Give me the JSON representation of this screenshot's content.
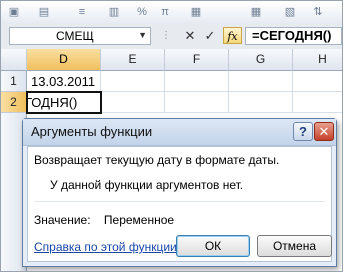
{
  "formula_bar": {
    "name_box": "СМЕЩ",
    "cancel_glyph": "✕",
    "enter_glyph": "✓",
    "fx_label": "fx",
    "formula": "=СЕГОДНЯ()"
  },
  "grid": {
    "columns": [
      "D",
      "E",
      "F",
      "G",
      "H"
    ],
    "rows": [
      "1",
      "2"
    ],
    "cells": {
      "d1": "13.03.2011",
      "d2": "ГОДНЯ()"
    }
  },
  "dialog": {
    "title": "Аргументы функции",
    "help_button": "?",
    "close_button": "✕",
    "description": "Возвращает текущую дату в формате даты.",
    "no_args": "У данной функции аргументов нет.",
    "value_label": "Значение:",
    "value_text": "Переменное",
    "help_link": "Справка по этой функции",
    "ok_label": "ОК",
    "cancel_label": "Отмена"
  },
  "colors": {
    "selected_header": "#f0bf5d",
    "dialog_border": "#5f7da3",
    "close_button": "#c5412a",
    "link": "#1a46a8"
  },
  "icons": [
    "paste-icon",
    "font-color-icon",
    "align-icon",
    "currency-icon",
    "percent-icon",
    "pi-icon",
    "format-icon",
    "grid-icon",
    "cell-style-icon",
    "sort-icon"
  ]
}
